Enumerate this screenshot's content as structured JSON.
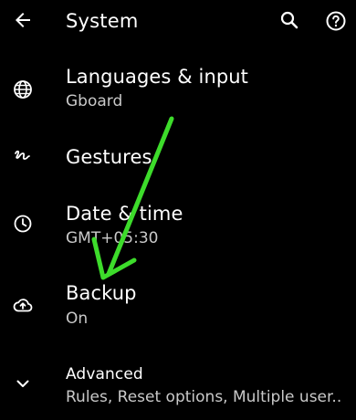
{
  "header": {
    "title": "System",
    "back_icon": "arrow-back-icon",
    "search_icon": "search-icon",
    "help_icon": "help-icon"
  },
  "settings": {
    "languages": {
      "title": "Languages & input",
      "summary": "Gboard",
      "icon": "globe-icon"
    },
    "gestures": {
      "title": "Gestures",
      "icon": "gesture-icon"
    },
    "datetime": {
      "title": "Date & time",
      "summary": "GMT+05:30",
      "icon": "clock-icon"
    },
    "backup": {
      "title": "Backup",
      "summary": "On",
      "icon": "cloud-upload-icon"
    },
    "advanced": {
      "title": "Advanced",
      "summary": "Rules, Reset options, Multiple user..",
      "icon": "chevron-down-icon"
    }
  },
  "annotation": {
    "arrow_color": "#3ddc2b",
    "icon": "green-arrow-annotation"
  },
  "colors": {
    "background": "#000000",
    "text": "#ffffff",
    "summary_text": "#c9c9c9"
  }
}
